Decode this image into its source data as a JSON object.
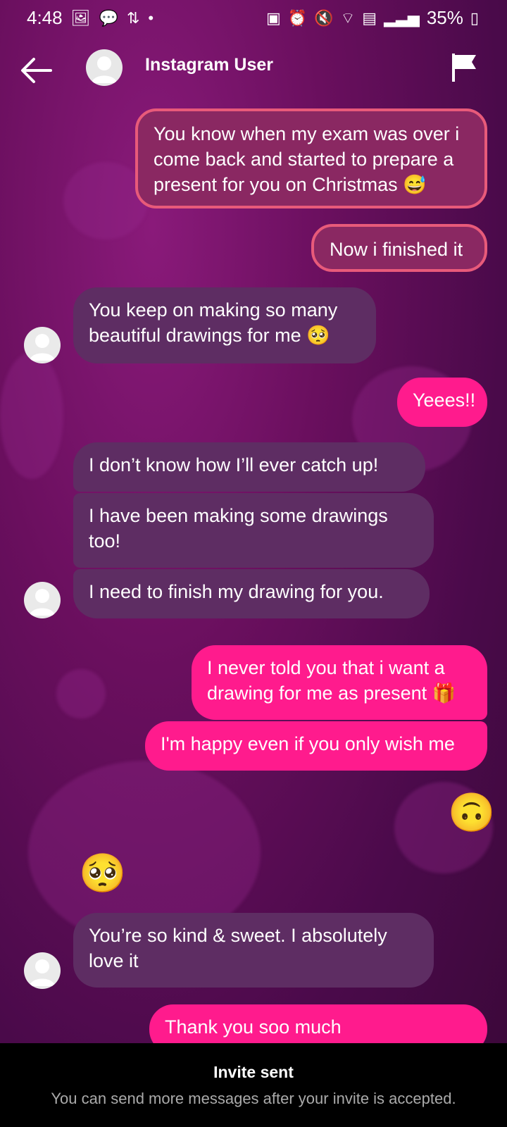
{
  "status": {
    "time": "4:48",
    "battery": "35%",
    "left_icons": [
      "image-icon",
      "chat-bubble-icon",
      "data-arrows-icon",
      "dot-icon"
    ],
    "right_icons": [
      "vibrate-icon",
      "alarm-icon",
      "mute-icon",
      "wifi-icon",
      "volte-icon",
      "signal-icon",
      "battery-icon"
    ]
  },
  "header": {
    "title": "Instagram User",
    "back_icon": "arrow-left-icon",
    "flag_icon": "flag-icon"
  },
  "messages": [
    {
      "text": "You know when my exam was over i come back and started to prepare a present for you on Christmas 😅"
    },
    {
      "text": "Now i finished it"
    },
    {
      "text": "You keep on making so many beautiful drawings for me 🥺"
    },
    {
      "text": "Yeees!!"
    },
    {
      "text": "I don’t know how I’ll ever catch up!"
    },
    {
      "text": "I have been making some drawings too!"
    },
    {
      "text": "I need to finish my drawing for you."
    },
    {
      "text": "I never told you that i want a drawing for me as present 🎁"
    },
    {
      "text": "I'm happy even if you only wish me"
    },
    {
      "text": "🙃"
    },
    {
      "text": "🥺"
    },
    {
      "text": "You’re so kind & sweet. I absolutely love it"
    },
    {
      "text": "Thank you soo much"
    }
  ],
  "banner": {
    "title": "Invite sent",
    "subtitle": "You can send more messages after your invite is accepted."
  },
  "colors": {
    "sent_bubble": "#ff1b8d",
    "received_bubble": "#5e2d63",
    "outlined_bubble": "#8a2862",
    "outline": "#e85a7a",
    "banner_bg": "#000000"
  }
}
